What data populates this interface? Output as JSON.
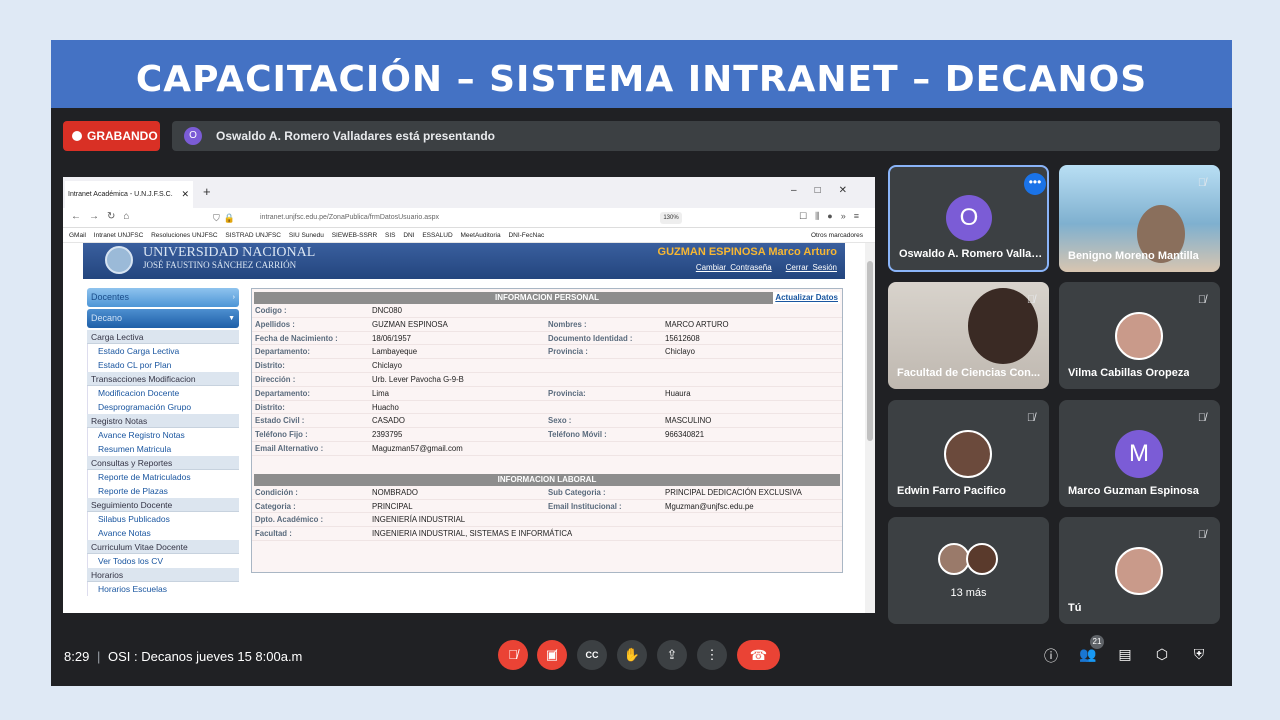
{
  "slide_title": "CAPACITACIÓN – SISTEMA INTRANET – DECANOS",
  "recording": {
    "label": "GRABANDO"
  },
  "presenter": {
    "initial": "O",
    "text": "Oswaldo A. Romero Valladares está presentando"
  },
  "browser": {
    "tab_title": "Intranet Académica - U.N.J.F.S.C.",
    "url": "intranet.unjfsc.edu.pe/ZonaPublica/frmDatosUsuario.aspx",
    "zoom": "130%",
    "bookmarks": [
      "GMail",
      "Intranet UNJFSC",
      "Resoluciones UNJFSC",
      "SISTRAD UNJFSC",
      "SIU Sunedu",
      "SIEWEB-SSRR",
      "SIS",
      "DNI",
      "ESSALUD",
      "MeetAuditoria",
      "DNI-FecNac"
    ],
    "other_bookmarks": "Otros marcadores"
  },
  "site": {
    "uni_line1": "UNIVERSIDAD NACIONAL",
    "uni_line2": "JOSÉ FAUSTINO SÁNCHEZ CARRIÓN",
    "user_name": "GUZMAN ESPINOSA Marco Arturo",
    "change_password": "Cambiar Contraseña",
    "logout": "Cerrar Sesión"
  },
  "menu": {
    "docentes": "Docentes",
    "decano": "Decano",
    "sections": [
      {
        "title": "Carga Lectiva",
        "items": [
          "Estado Carga Lectiva",
          "Estado CL por Plan"
        ]
      },
      {
        "title": "Transacciones Modificacion",
        "items": [
          "Modificacion Docente",
          "Desprogramación Grupo"
        ]
      },
      {
        "title": "Registro Notas",
        "items": [
          "Avance Registro Notas",
          "Resumen Matricula"
        ]
      },
      {
        "title": "Consultas y Reportes",
        "items": [
          "Reporte de Matriculados",
          "Reporte de Plazas"
        ]
      },
      {
        "title": "Seguimiento Docente",
        "items": [
          "Silabus Publicados",
          "Avance Notas"
        ]
      },
      {
        "title": "Curriculum Vitae Docente",
        "items": [
          "Ver Todos los CV"
        ]
      },
      {
        "title": "Horarios",
        "items": [
          "Horarios Escuelas"
        ]
      }
    ]
  },
  "personal": {
    "header": "INFORMACION PERSONAL",
    "update_link": "Actualizar Datos",
    "rows": [
      {
        "l": "Codigo :",
        "v": "DNC080",
        "l2": "",
        "v2": ""
      },
      {
        "l": "Apellidos :",
        "v": "GUZMAN ESPINOSA",
        "l2": "Nombres :",
        "v2": "MARCO ARTURO"
      },
      {
        "l": "Fecha de Nacimiento :",
        "v": "18/06/1957",
        "l2": "Documento Identidad :",
        "v2": "15612608"
      },
      {
        "l": "Departamento:",
        "v": "Lambayeque",
        "l2": "Provincia :",
        "v2": "Chiclayo"
      },
      {
        "l": "Distrito:",
        "v": "Chiclayo",
        "l2": "",
        "v2": ""
      },
      {
        "l": "Dirección :",
        "v": "Urb. Lever Pavocha G-9-B",
        "l2": "",
        "v2": ""
      },
      {
        "l": "Departamento:",
        "v": "Lima",
        "l2": "Provincia:",
        "v2": "Huaura"
      },
      {
        "l": "Distrito:",
        "v": "Huacho",
        "l2": "",
        "v2": ""
      },
      {
        "l": "Estado Civil :",
        "v": "CASADO",
        "l2": "Sexo :",
        "v2": "MASCULINO"
      },
      {
        "l": "Teléfono Fijo :",
        "v": "2393795",
        "l2": "Teléfono Móvil :",
        "v2": "966340821"
      },
      {
        "l": "Email Alternativo :",
        "v": "Maguzman57@gmail.com",
        "l2": "",
        "v2": ""
      }
    ]
  },
  "laboral": {
    "header": "INFORMACION LABORAL",
    "rows": [
      {
        "l": "Condición :",
        "v": "NOMBRADO",
        "l2": "Sub Categoria :",
        "v2": "PRINCIPAL DEDICACIÓN EXCLUSIVA"
      },
      {
        "l": "Categoria :",
        "v": "PRINCIPAL",
        "l2": "Email Institucional :",
        "v2": "Mguzman@unjfsc.edu.pe"
      },
      {
        "l": "Dpto. Académico :",
        "v": "INGENIERÍA INDUSTRIAL",
        "l2": "",
        "v2": ""
      },
      {
        "l": "Facultad :",
        "v": "INGENIERIA INDUSTRIAL, SISTEMAS E INFORMÁTICA",
        "l2": "",
        "v2": ""
      }
    ]
  },
  "participants": {
    "p1": {
      "name": "Oswaldo A. Romero Vallad...",
      "initial": "O",
      "color": "#7b5cd6"
    },
    "p2": {
      "name": "Benigno Moreno Mantilla"
    },
    "p3": {
      "name": "Facultad de Ciencias Con..."
    },
    "p4": {
      "name": "Vilma Cabillas Oropeza"
    },
    "p5": {
      "name": "Edwin Farro Pacifico"
    },
    "p6": {
      "name": "Marco Guzman Espinosa",
      "initial": "M",
      "color": "#7b5cd6"
    },
    "more": "13 más",
    "you": "Tú"
  },
  "bottom": {
    "time": "8:29",
    "meeting": "OSI : Decanos jueves 15 8:00a.m",
    "people_count": "21"
  }
}
